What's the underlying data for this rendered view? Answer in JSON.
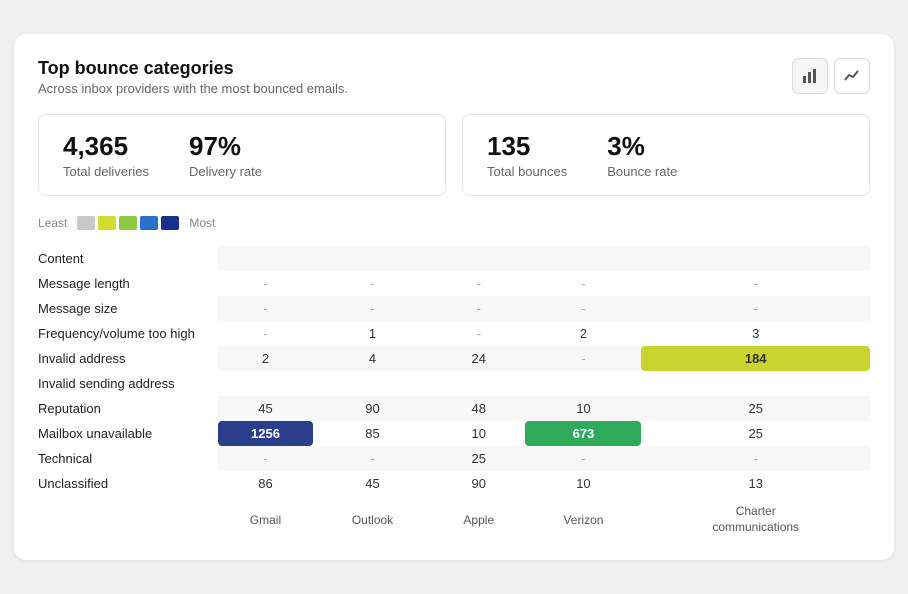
{
  "card": {
    "title": "Top bounce categories",
    "subtitle": "Across inbox providers with the most bounced emails."
  },
  "buttons": {
    "bar_chart_icon": "▦",
    "line_chart_icon": "⟋"
  },
  "stats": [
    {
      "value": "4,365",
      "label": "Total deliveries",
      "value2": "97%",
      "label2": "Delivery rate"
    },
    {
      "value": "135",
      "label": "Total bounces",
      "value2": "3%",
      "label2": "Bounce rate"
    }
  ],
  "legend": {
    "least": "Least",
    "most": "Most",
    "colors": [
      "#c8c8c8",
      "#d4dc30",
      "#8dc840",
      "#2870c8",
      "#1a2e8c"
    ]
  },
  "table": {
    "columns": [
      "",
      "Gmail",
      "Outlook",
      "Apple",
      "Verizon",
      "Charter\ncommunications"
    ],
    "rows": [
      {
        "category": "Content",
        "values": [
          "",
          "",
          "",
          "",
          ""
        ]
      },
      {
        "category": "Message length",
        "values": [
          "-",
          "-",
          "-",
          "-",
          "-"
        ]
      },
      {
        "category": "Message size",
        "values": [
          "-",
          "-",
          "-",
          "-",
          "-"
        ]
      },
      {
        "category": "Frequency/volume too high",
        "values": [
          "-",
          "1",
          "-",
          "2",
          "3"
        ]
      },
      {
        "category": "Invalid address",
        "values": [
          "2",
          "4",
          "24",
          "-",
          "184"
        ]
      },
      {
        "category": "Invalid sending address",
        "values": [
          "",
          "",
          "",
          "",
          ""
        ]
      },
      {
        "category": "Reputation",
        "values": [
          "45",
          "90",
          "48",
          "10",
          "25"
        ]
      },
      {
        "category": "Mailbox unavailable",
        "values": [
          "1256",
          "85",
          "10",
          "673",
          "25"
        ]
      },
      {
        "category": "Technical",
        "values": [
          "-",
          "-",
          "25",
          "-",
          "-"
        ]
      },
      {
        "category": "Unclassified",
        "values": [
          "86",
          "45",
          "90",
          "10",
          "13"
        ]
      }
    ],
    "highlights": {
      "mailbox_unavailable_gmail": "blue",
      "mailbox_unavailable_verizon": "green",
      "invalid_address_charter": "yellow"
    }
  }
}
